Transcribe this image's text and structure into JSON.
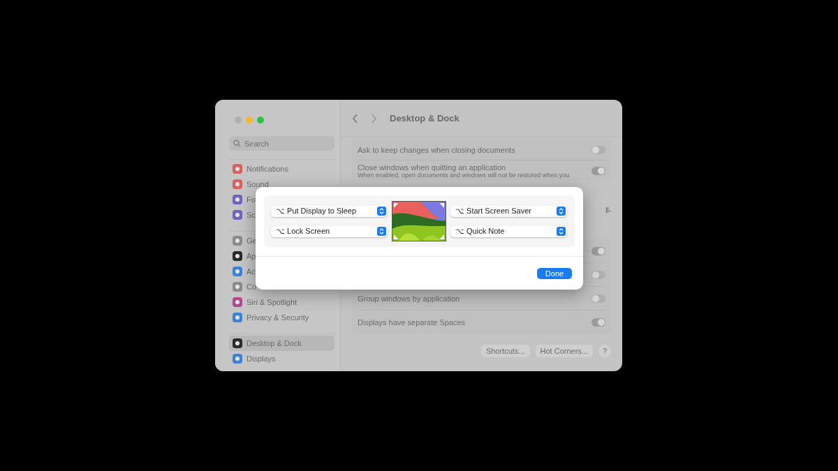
{
  "window": {
    "title": "Desktop & Dock"
  },
  "sidebar": {
    "search": {
      "placeholder": "Search"
    },
    "groups": [
      [
        {
          "label": "Notifications",
          "color": "#d9605f",
          "selected": false
        },
        {
          "label": "Sound",
          "color": "#d9605f",
          "selected": false
        },
        {
          "label": "Fo",
          "color": "#6d64c4",
          "selected": false
        },
        {
          "label": "Sc",
          "color": "#6d64c4",
          "selected": false
        }
      ],
      [
        {
          "label": "Ge",
          "color": "#8c8c8c",
          "selected": false
        },
        {
          "label": "Ap",
          "color": "#2b2b2b",
          "selected": false
        },
        {
          "label": "Ac",
          "color": "#3b82d9",
          "selected": false
        },
        {
          "label": "Co",
          "color": "#8c8c8c",
          "selected": false
        },
        {
          "label": "Siri & Spotlight",
          "color": "#b04a8c",
          "selected": false
        },
        {
          "label": "Privacy & Security",
          "color": "#3b82d9",
          "selected": false
        }
      ],
      [
        {
          "label": "Desktop & Dock",
          "color": "#2b2b2b",
          "selected": true
        },
        {
          "label": "Displays",
          "color": "#3b82d9",
          "selected": false
        }
      ]
    ]
  },
  "settings": {
    "card_1": [
      {
        "label": "Ask to keep changes when closing documents",
        "on": false
      },
      {
        "label": "Close windows when quitting an application",
        "description": "When enabled, open documents and windows will not be restored when you",
        "on": true
      }
    ],
    "fragment": "ll-",
    "card_2": [
      {
        "on": true
      },
      {
        "on": false
      },
      {
        "label": "Group windows by application",
        "on": false
      },
      {
        "label": "Displays have separate Spaces",
        "on": true
      }
    ],
    "buttons": [
      "Shortcuts...",
      "Hot Corners...",
      "?"
    ]
  },
  "hot_corners_dialog": {
    "corners": [
      {
        "label": "⌥ Put Display to Sleep"
      },
      {
        "label": "⌥ Start Screen Saver"
      },
      {
        "label": "⌥ Lock Screen"
      },
      {
        "label": "⌥ Quick Note"
      }
    ],
    "button": "Done"
  }
}
